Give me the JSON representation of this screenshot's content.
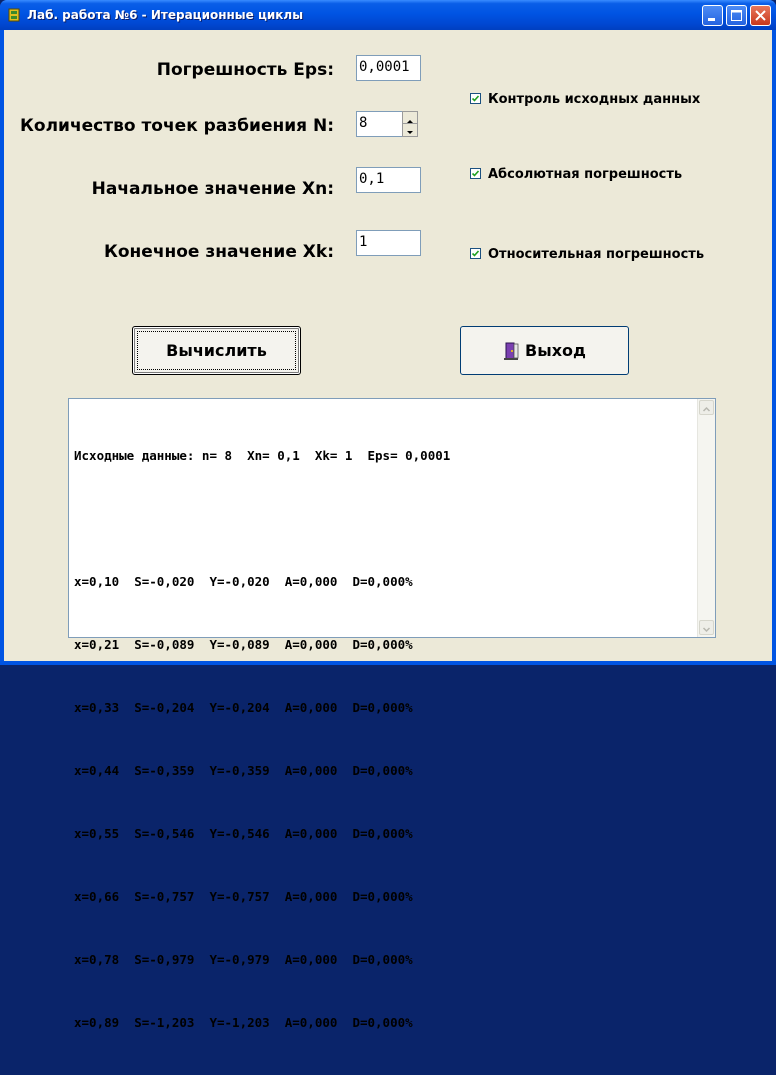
{
  "window": {
    "title": "Лаб. работа №6 - Итерационные циклы"
  },
  "fields": {
    "eps": {
      "label": "Погрешность Eps:",
      "value": "0,0001"
    },
    "n": {
      "label": "Количество точек разбиения N:",
      "value": "8"
    },
    "xn": {
      "label": "Начальное значение Xn:",
      "value": "0,1"
    },
    "xk": {
      "label": "Конечное значение Xk:",
      "value": "1"
    }
  },
  "checkboxes": [
    {
      "label": "Контроль исходных данных",
      "checked": true
    },
    {
      "label": "Абсолютная погрешность",
      "checked": true
    },
    {
      "label": "Относительная погрешность",
      "checked": true
    }
  ],
  "buttons": {
    "compute": "Вычислить",
    "exit": "Выход"
  },
  "output": {
    "lines": [
      "Исходные данные: n= 8  Xn= 0,1  Xk= 1  Eps= 0,0001",
      "",
      "x=0,10  S=-0,020  Y=-0,020  A=0,000  D=0,000%",
      "x=0,21  S=-0,089  Y=-0,089  A=0,000  D=0,000%",
      "x=0,33  S=-0,204  Y=-0,204  A=0,000  D=0,000%",
      "x=0,44  S=-0,359  Y=-0,359  A=0,000  D=0,000%",
      "x=0,55  S=-0,546  Y=-0,546  A=0,000  D=0,000%",
      "x=0,66  S=-0,757  Y=-0,757  A=0,000  D=0,000%",
      "x=0,78  S=-0,979  Y=-0,979  A=0,000  D=0,000%",
      "x=0,89  S=-1,203  Y=-1,203  A=0,000  D=0,000%"
    ]
  },
  "colors": {
    "titlebar": "#0054e3",
    "client": "#ece9d8",
    "edit_border": "#7f9db9"
  }
}
